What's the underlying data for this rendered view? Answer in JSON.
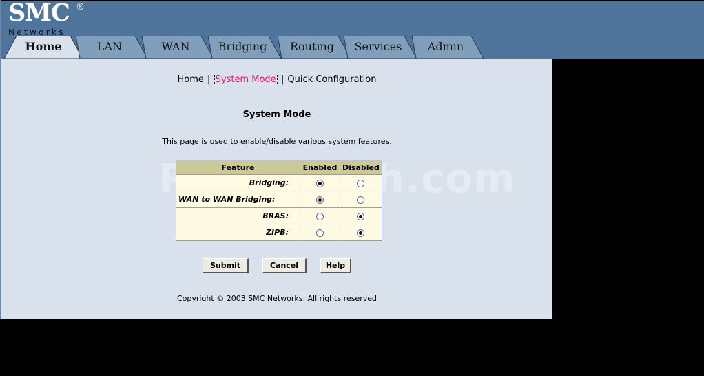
{
  "logo": {
    "brand": "SMC",
    "registered": "®",
    "sub": "Networks"
  },
  "tabs": [
    {
      "label": "Home",
      "active": true
    },
    {
      "label": "LAN",
      "active": false
    },
    {
      "label": "WAN",
      "active": false
    },
    {
      "label": "Bridging",
      "active": false
    },
    {
      "label": "Routing",
      "active": false
    },
    {
      "label": "Services",
      "active": false
    },
    {
      "label": "Admin",
      "active": false
    }
  ],
  "breadcrumb": {
    "home": "Home",
    "current": "System Mode",
    "quick": "Quick Configuration",
    "separator": "|"
  },
  "page": {
    "title": "System Mode",
    "description": "This page is used to enable/disable various system features.",
    "watermark": "PcWinTech.com",
    "copyright": "Copyright © 2003 SMC Networks. All rights reserved"
  },
  "table": {
    "headers": {
      "feature": "Feature",
      "enabled": "Enabled",
      "disabled": "Disabled"
    },
    "rows": [
      {
        "label": "Bridging:",
        "enabled": true
      },
      {
        "label": "WAN to WAN Bridging:",
        "enabled": true
      },
      {
        "label": "BRAS:",
        "enabled": false
      },
      {
        "label": "ZIPB:",
        "enabled": false
      }
    ]
  },
  "buttons": {
    "submit": "Submit",
    "cancel": "Cancel",
    "help": "Help"
  },
  "colors": {
    "topbar": "#4f759d",
    "content_bg": "#d9e1ec",
    "table_header": "#cbc99a",
    "table_cell": "#fffbe2",
    "breadcrumb_current": "#e0176f",
    "tab_inactive": "#7f9fbd",
    "tab_active": "#d9e1ec"
  }
}
